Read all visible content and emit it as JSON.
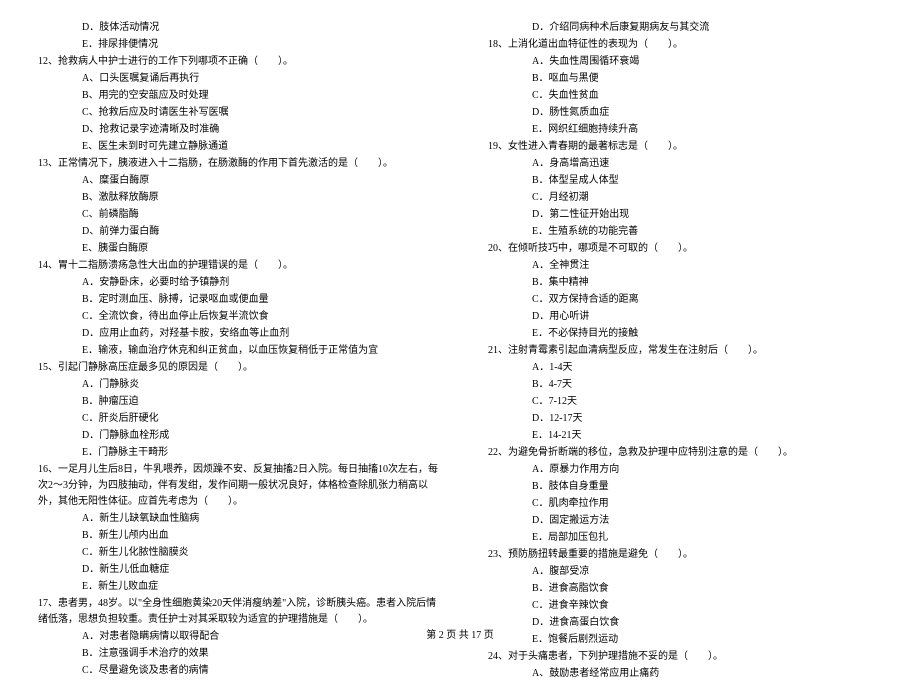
{
  "left": {
    "pre_options": [
      "D．肢体活动情况",
      "E．排尿排便情况"
    ],
    "questions": [
      {
        "stem": "12、抢救病人中护士进行的工作下列哪项不正确（　　）。",
        "options": [
          "A、口头医嘱复诵后再执行",
          "B、用完的空安瓿应及时处理",
          "C、抢救后应及时请医生补写医嘱",
          "D、抢救记录字迹清晰及时准确",
          "E、医生未到时可先建立静脉通道"
        ]
      },
      {
        "stem": "13、正常情况下，胰液进入十二指肠，在肠激酶的作用下首先激活的是（　　）。",
        "options": [
          "A、糜蛋白酶原",
          "B、激肽释放酶原",
          "C、前磷脂酶",
          "D、前弹力蛋白酶",
          "E、胰蛋白酶原"
        ]
      },
      {
        "stem": "14、胃十二指肠溃疡急性大出血的护理错误的是（　　）。",
        "options": [
          "A．安静卧床，必要时给予镇静剂",
          "B．定时测血压、脉搏，记录呕血或便血量",
          "C．全流饮食，待出血停止后恢复半流饮食",
          "D．应用止血药，对羟基卡胺，安络血等止血剂",
          "E．输液，输血治疗休克和纠正贫血，以血压恢复稍低于正常值为宜"
        ]
      },
      {
        "stem": "15、引起门静脉高压症最多见的原因是（　　）。",
        "options": [
          "A．门静脉炎",
          "B．肿瘤压迫",
          "C．肝炎后肝硬化",
          "D．门静脉血栓形成",
          "E．门静脉主干畸形"
        ]
      },
      {
        "stem": "16、一足月儿生后8日，牛乳喂养，因烦躁不安、反复抽搐2日入院。每日抽搐10次左右，每次2～3分钟，为四肢抽动，伴有发绀，发作间期一般状况良好，体格检查除肌张力稍高以外，其他无阳性体征。应首先考虑为（　　）。",
        "options": [
          "A．新生儿缺氧缺血性脑病",
          "B．新生儿颅内出血",
          "C．新生儿化脓性脑膜炎",
          "D．新生儿低血糖症",
          "E．新生儿败血症"
        ]
      },
      {
        "stem": "17、患者男，48岁。以\"全身性细胞黄染20天伴消瘦纳差\"入院，诊断胰头癌。患者入院后情绪低落，思想负担较重。责任护士对其采取较为适宜的护理措施是（　　）。",
        "options": [
          "A．对患者隐瞒病情以取得配合",
          "B．注意强调手术治疗的效果",
          "C．尽量避免谈及患者的病情"
        ]
      }
    ]
  },
  "right": {
    "pre_options": [
      "D．介绍同病种术后康复期病友与其交流"
    ],
    "questions": [
      {
        "stem": "18、上消化道出血特征性的表现为（　　）。",
        "options": [
          "A．失血性周围循环衰竭",
          "B．呕血与黑便",
          "C．失血性贫血",
          "D．肠性氮质血症",
          "E．网织红细胞持续升高"
        ]
      },
      {
        "stem": "19、女性进入青春期的最著标志是（　　）。",
        "options": [
          "A．身高增高迅速",
          "B．体型呈成人体型",
          "C．月经初潮",
          "D．第二性征开始出现",
          "E．生殖系统的功能完善"
        ]
      },
      {
        "stem": "20、在倾听技巧中，哪项是不可取的（　　）。",
        "options": [
          "A．全神贯注",
          "B．集中精神",
          "C．双方保持合适的距离",
          "D．用心听讲",
          "E．不必保持目光的接触"
        ]
      },
      {
        "stem": "21、注射青霉素引起血清病型反应，常发生在注射后（　　）。",
        "options": [
          "A．1-4天",
          "B．4-7天",
          "C．7-12天",
          "D．12-17天",
          "E．14-21天"
        ]
      },
      {
        "stem": "22、为避免骨折断端的移位，急救及护理中应特别注意的是（　　）。",
        "options": [
          "A．原暴力作用方向",
          "B．肢体自身重量",
          "C．肌肉牵拉作用",
          "D．固定搬运方法",
          "E．局部加压包扎"
        ]
      },
      {
        "stem": "23、预防肠扭转最重要的措施是避免（　　）。",
        "options": [
          "A．腹部受凉",
          "B．进食高脂饮食",
          "C．进食辛辣饮食",
          "D．进食高蛋白饮食",
          "E．饱餐后剧烈运动"
        ]
      },
      {
        "stem": "24、对于头痛患者，下列护理措施不妥的是（　　）。",
        "options": [
          "A、鼓励患者经常应用止痛药"
        ]
      }
    ]
  },
  "footer": "第 2 页 共 17 页"
}
